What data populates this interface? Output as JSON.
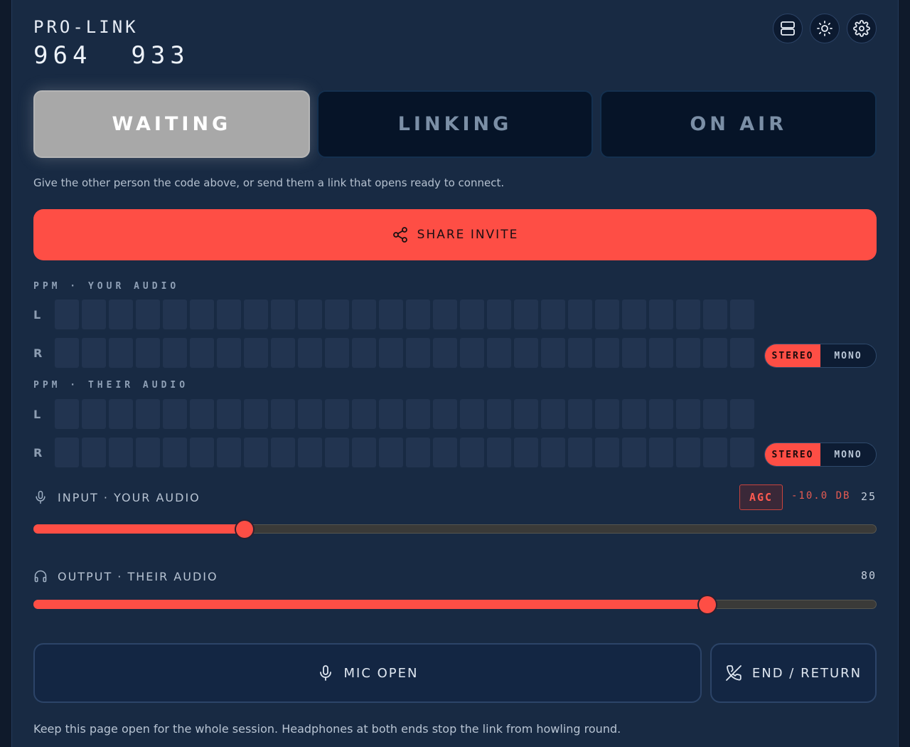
{
  "brand": {
    "name": "PRO-LINK",
    "code": "964  933"
  },
  "top_icons": [
    {
      "name": "server-icon"
    },
    {
      "name": "sun-icon"
    },
    {
      "name": "gear-icon"
    }
  ],
  "states": [
    {
      "label": "WAITING",
      "active": true
    },
    {
      "label": "LINKING",
      "active": false
    },
    {
      "label": "ON AIR",
      "active": false
    }
  ],
  "hint": "Give the other person the code above, or send them a link that opens ready to connect.",
  "share": {
    "label": "SHARE INVITE",
    "icon": "share-icon"
  },
  "meters": {
    "yours": {
      "title": "PPM · YOUR AUDIO",
      "left": "L",
      "right": "R",
      "segments": 26,
      "level_left": 0,
      "level_right": 0,
      "mode": {
        "stereo": "STEREO",
        "mono": "MONO",
        "selected": "STEREO"
      }
    },
    "theirs": {
      "title": "PPM · THEIR AUDIO",
      "left": "L",
      "right": "R",
      "segments": 26,
      "level_left": 0,
      "level_right": 0,
      "mode": {
        "stereo": "STEREO",
        "mono": "MONO",
        "selected": "STEREO"
      }
    }
  },
  "input": {
    "label": "INPUT · YOUR AUDIO",
    "agc": "AGC",
    "gain_db": "-10.0 DB",
    "value": "25",
    "level": 25
  },
  "output": {
    "label": "OUTPUT · THEIR AUDIO",
    "value": "80",
    "level": 80
  },
  "buttons": {
    "mic": "MIC OPEN",
    "end": "END / RETURN"
  },
  "footer": "Keep this page open for the whole session. Headphones at both ends stop the link from howling round.",
  "colors": {
    "accent": "#fe4e45",
    "background": "#182a43",
    "waiting": "#a8a8a8"
  }
}
